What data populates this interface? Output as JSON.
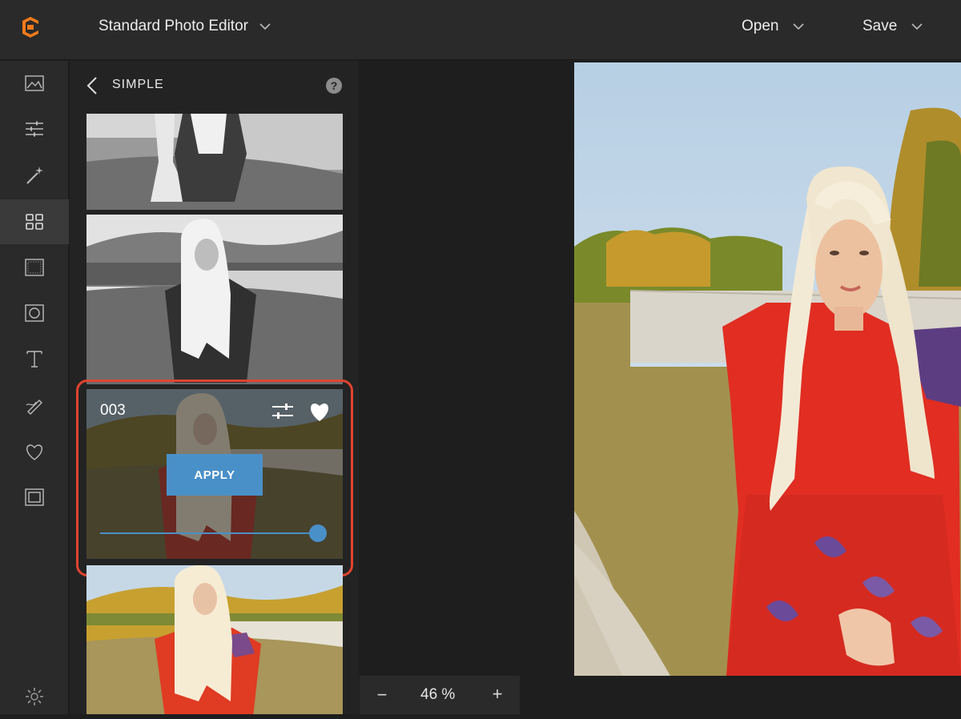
{
  "header": {
    "title": "Standard Photo Editor",
    "open_label": "Open",
    "save_label": "Save"
  },
  "rail": {
    "items": [
      "image-icon",
      "sliders-icon",
      "magic-wand-icon",
      "grid-icon",
      "texture-icon",
      "frame-circle-icon",
      "text-icon",
      "brush-icon",
      "heart-icon",
      "border-icon"
    ],
    "active": "grid-icon",
    "bottom": "gear-icon"
  },
  "panel": {
    "title": "SIMPLE",
    "help": "?",
    "selected_filter": {
      "name": "003",
      "apply_label": "APPLY",
      "intensity": 1.0
    }
  },
  "zoom": {
    "minus": "−",
    "value": "46 %",
    "plus": "+"
  },
  "colors": {
    "accent": "#4a90c8",
    "highlight": "#e0442f",
    "logo": "#f07a1a"
  }
}
